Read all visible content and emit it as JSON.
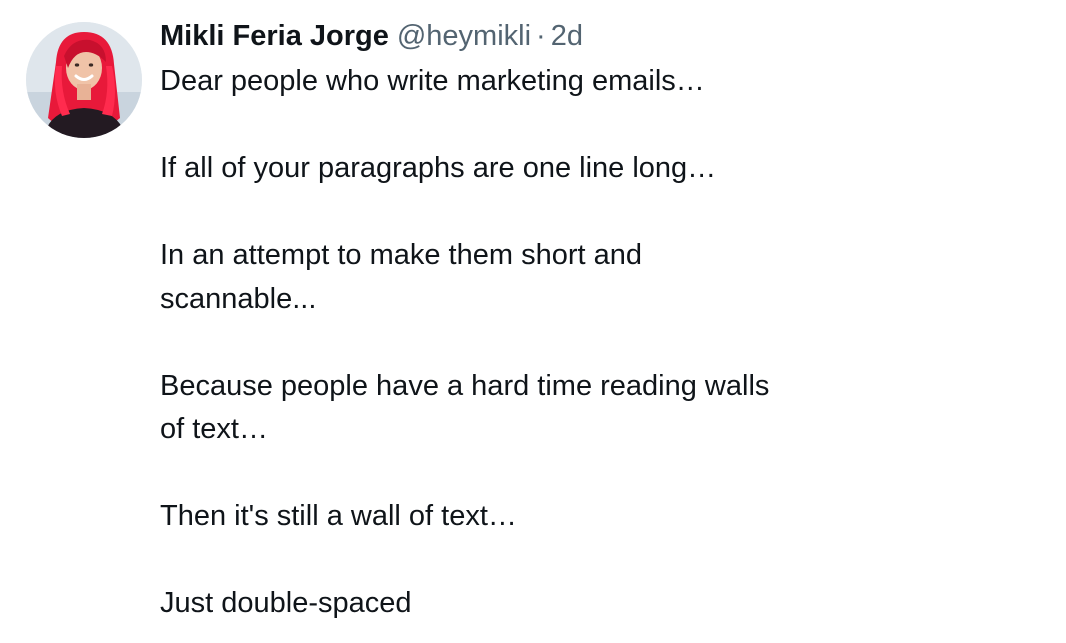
{
  "tweet": {
    "author": {
      "display_name": "Mikli Feria Jorge",
      "handle": "@heymikli",
      "separator": "·",
      "timestamp": "2d",
      "avatar_icon": "profile-photo-avatar"
    },
    "paragraphs": [
      "Dear people who write marketing emails…",
      "If all of your paragraphs are one line long…",
      "In an attempt to make them short and scannable...",
      "Because people have a hard time reading walls of text…",
      "Then it's still a wall of text…",
      "Just double-spaced"
    ]
  },
  "colors": {
    "text_primary": "#0f1419",
    "text_secondary": "#536471",
    "background": "#ffffff",
    "avatar_hair": "#e8193a"
  }
}
